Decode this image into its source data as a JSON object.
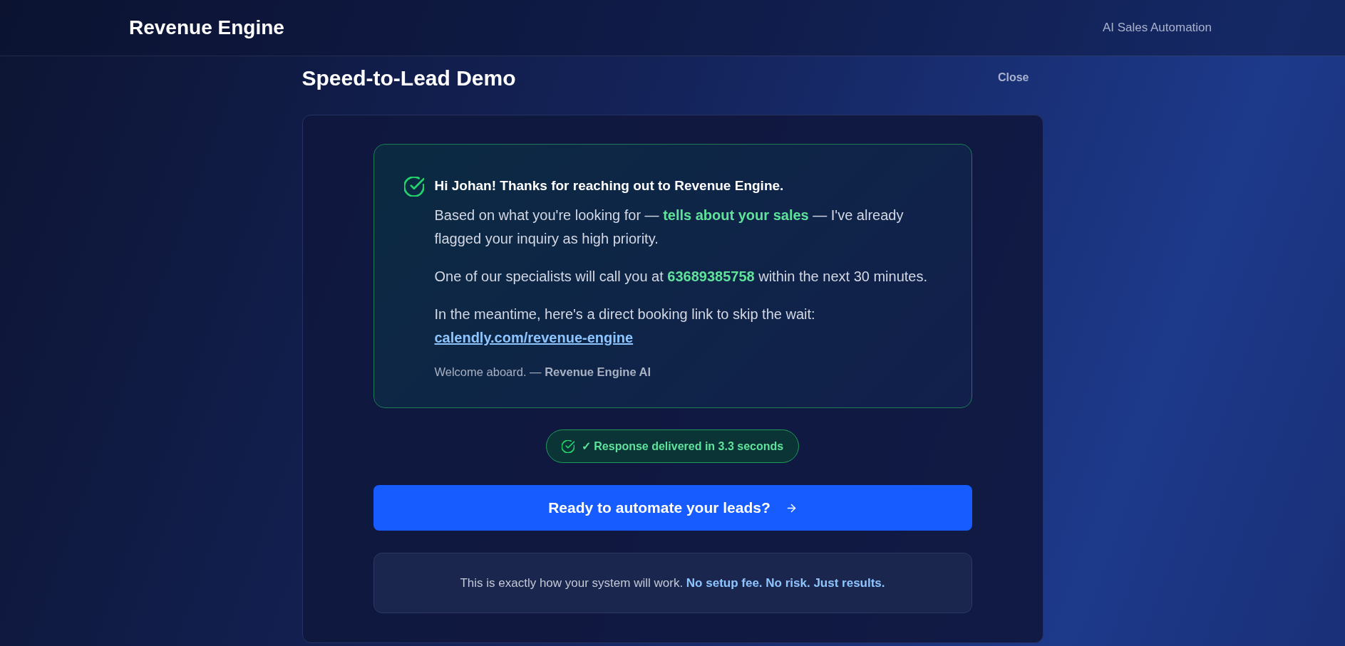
{
  "header": {
    "brand": "Revenue Engine",
    "tagline": "AI Sales Automation"
  },
  "demo": {
    "title": "Speed-to-Lead Demo",
    "close_label": "Close"
  },
  "message": {
    "greeting": "Hi Johan! Thanks for reaching out to Revenue Engine.",
    "paragraphs": [
      {
        "segments": [
          {
            "kind": "text",
            "text": "Based on what you're looking for — "
          },
          {
            "kind": "highlight",
            "text": "tells about your sales"
          },
          {
            "kind": "text",
            "text": " — I've already flagged your inquiry as high priority."
          }
        ]
      },
      {
        "segments": [
          {
            "kind": "text",
            "text": "One of our specialists will call you at "
          },
          {
            "kind": "highlight",
            "text": "63689385758"
          },
          {
            "kind": "text",
            "text": " within the next 30 minutes."
          }
        ]
      },
      {
        "segments": [
          {
            "kind": "text",
            "text": "In the meantime, here's a direct booking link to skip the wait: "
          },
          {
            "kind": "link",
            "text": "calendly.com/revenue-engine"
          }
        ]
      }
    ],
    "signoff": "Welcome aboard. — **Revenue Engine AI**"
  },
  "status_badge": {
    "text": "✓ Response delivered in 3.3 seconds"
  },
  "cta_button": {
    "label": "Ready to automate your leads?"
  },
  "footer_note": {
    "segments": [
      {
        "kind": "text",
        "text": "This is exactly how your system will work. "
      },
      {
        "kind": "highlight",
        "text": "No setup fee. No risk. Just results."
      }
    ]
  }
}
